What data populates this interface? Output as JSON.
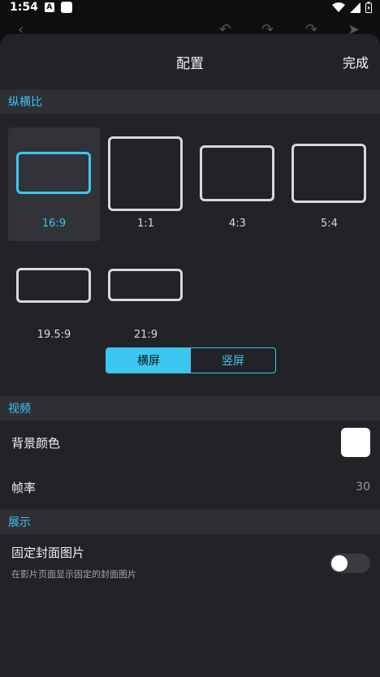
{
  "status_bar": {
    "time": "1:54",
    "notif_letter": "A"
  },
  "header": {
    "title": "配置",
    "done_label": "完成"
  },
  "aspect_section": {
    "title": "纵横比",
    "ratios": [
      {
        "label": "16:9",
        "selected": true
      },
      {
        "label": "1:1",
        "selected": false
      },
      {
        "label": "4:3",
        "selected": false
      },
      {
        "label": "5:4",
        "selected": false
      },
      {
        "label": "19.5:9",
        "selected": false
      },
      {
        "label": "21:9",
        "selected": false
      }
    ],
    "orientation": {
      "landscape": "横屏",
      "portrait": "竖屏",
      "selected": "landscape"
    }
  },
  "video_section": {
    "title": "视频",
    "background_color": {
      "label": "背景颜色",
      "value": "#ffffff"
    },
    "frame_rate": {
      "label": "帧率",
      "value": "30"
    }
  },
  "display_section": {
    "title": "展示",
    "fixed_cover": {
      "label": "固定封面图片",
      "description": "在影片页面显示固定的封面图片",
      "enabled": false
    }
  },
  "colors": {
    "accent": "#3cc6f0",
    "sheet_bg": "#222326",
    "section_bg": "#2f3034"
  }
}
